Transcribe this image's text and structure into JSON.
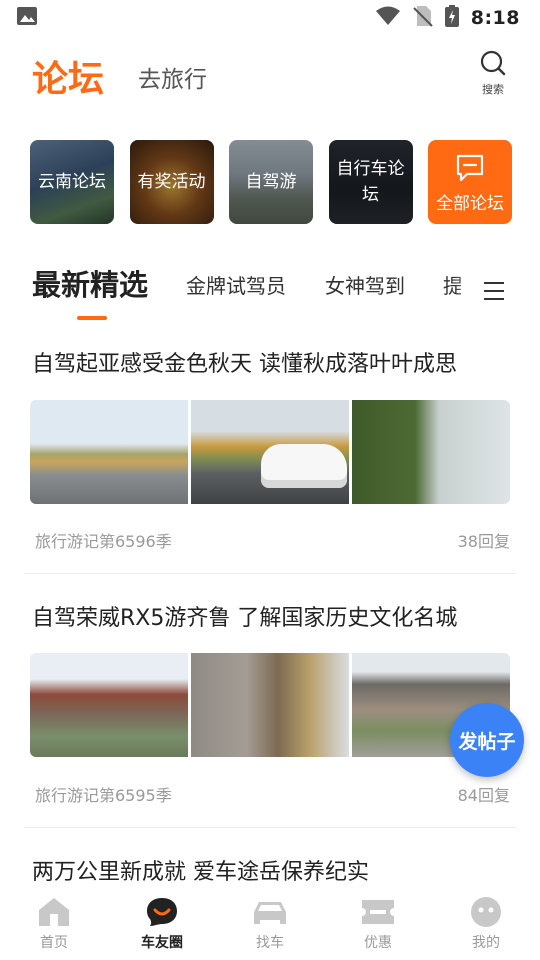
{
  "status_bar": {
    "time": "8:18",
    "icons": [
      "image-icon",
      "wifi-icon",
      "no-sim-icon",
      "battery-charging-icon"
    ]
  },
  "header": {
    "title": "论坛",
    "alt_title": "去旅行",
    "search_label": "搜索"
  },
  "forum_tiles": [
    {
      "label": "云南论坛"
    },
    {
      "label": "有奖活动"
    },
    {
      "label": "自驾游"
    },
    {
      "label": "自行车论坛"
    },
    {
      "label": "全部论坛"
    }
  ],
  "tabs": {
    "active": "最新精选",
    "items": [
      "金牌试驾员",
      "女神驾到",
      "提"
    ]
  },
  "posts": [
    {
      "title": "自驾起亚感受金色秋天 读懂秋成落叶叶成思",
      "meta": "旅行游记第6596季",
      "replies": "38回复"
    },
    {
      "title": "自驾荣威RX5游齐鲁 了解国家历史文化名城",
      "meta": "旅行游记第6595季",
      "replies": "84回复"
    },
    {
      "title": "两万公里新成就 爱车途岳保养纪实"
    }
  ],
  "fab": {
    "label": "发帖子"
  },
  "bottom_nav": [
    {
      "label": "首页",
      "icon": "home-icon"
    },
    {
      "label": "车友圈",
      "icon": "chat-smile-icon",
      "active": true
    },
    {
      "label": "找车",
      "icon": "car-icon"
    },
    {
      "label": "优惠",
      "icon": "ticket-icon"
    },
    {
      "label": "我的",
      "icon": "profile-face-icon"
    }
  ],
  "colors": {
    "accent": "#ff6a13",
    "fab": "#3b82f6",
    "muted": "#9a9a9a"
  }
}
